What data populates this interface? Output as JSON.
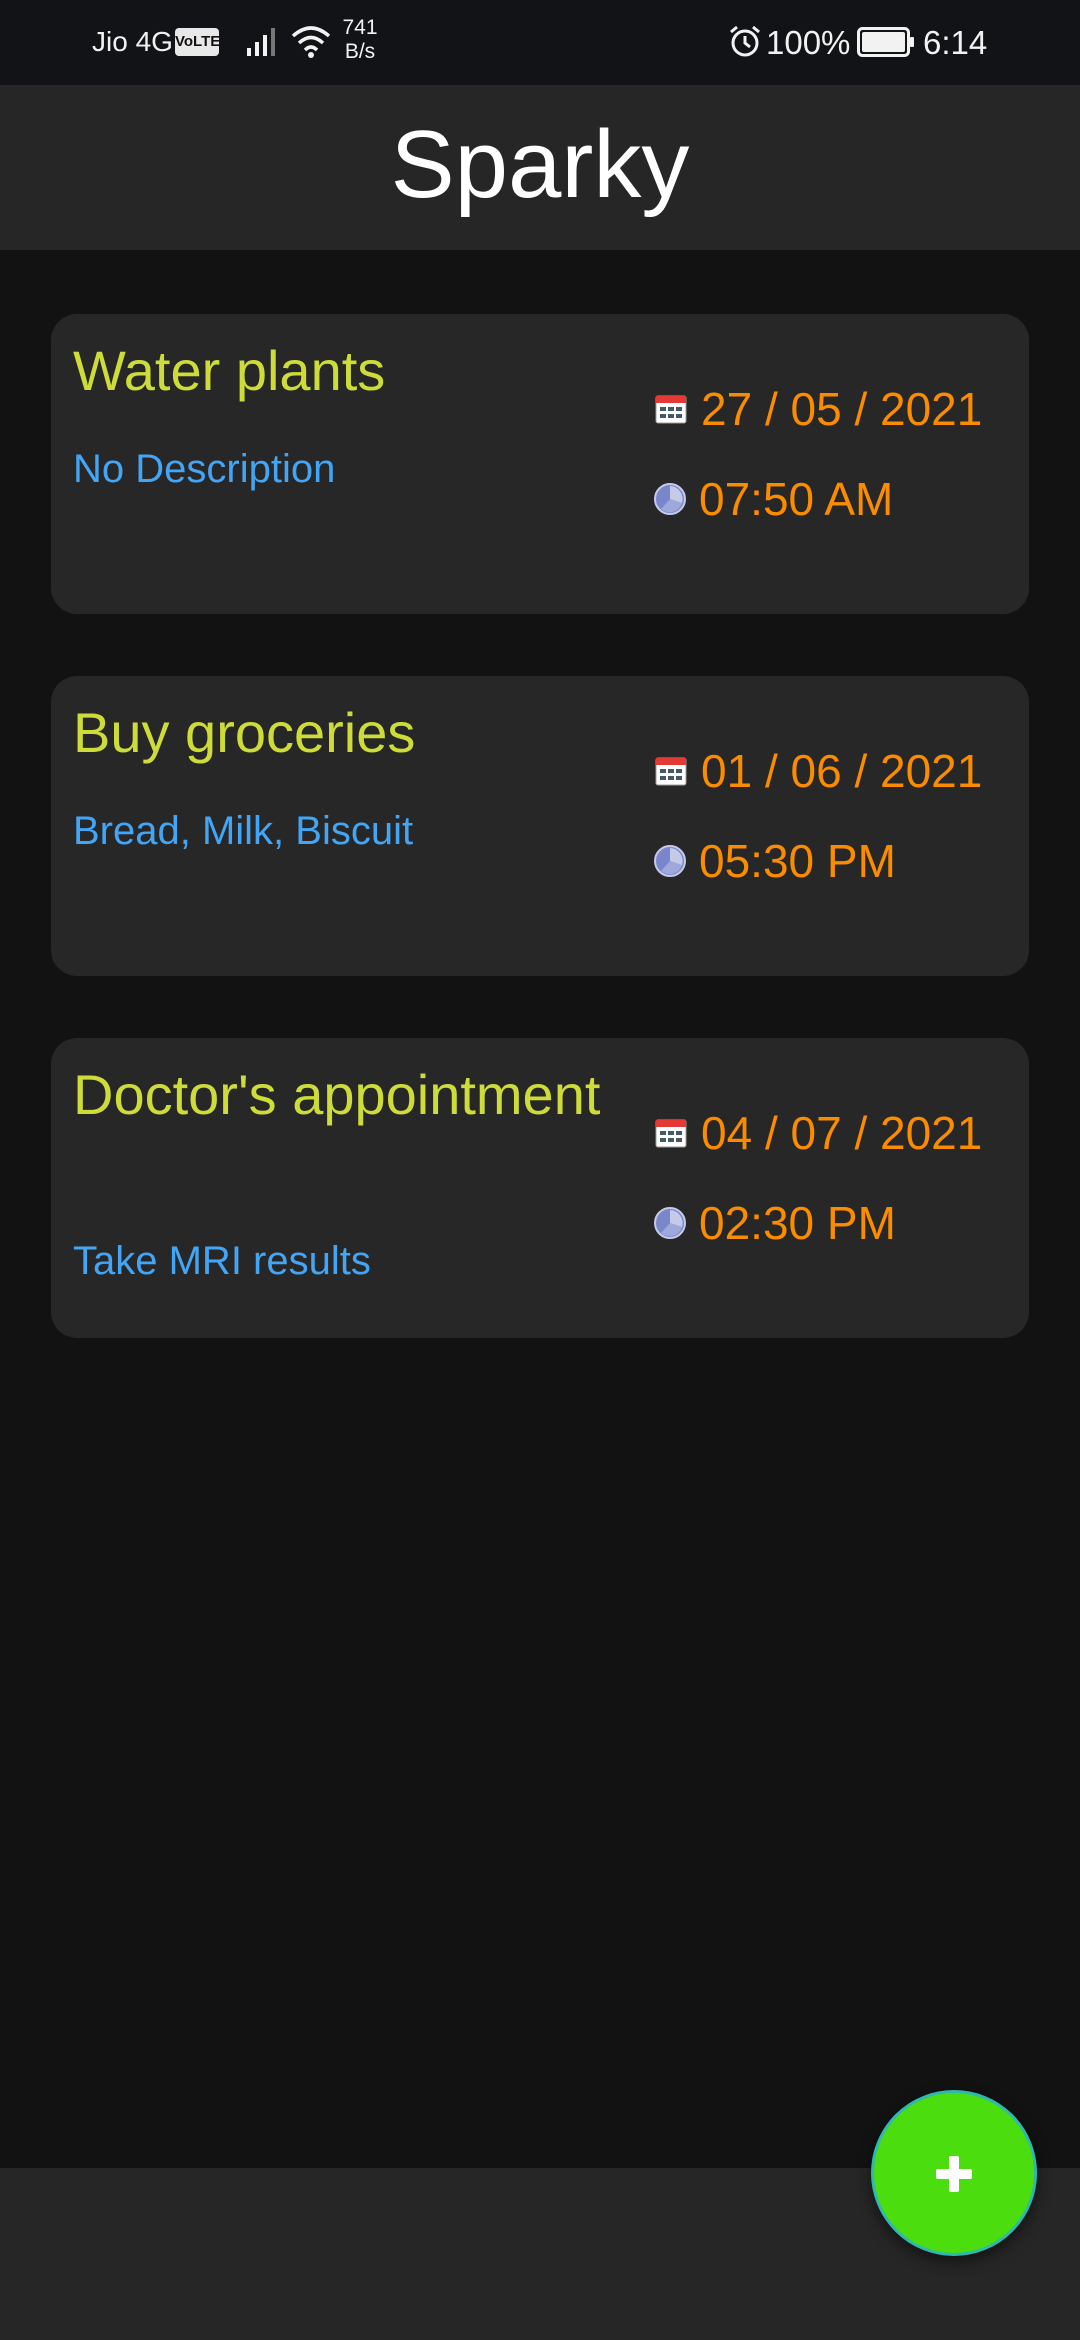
{
  "status_bar": {
    "carrier": "Jio 4G",
    "volte_badge": "VoLTE",
    "net_speed_value": "741",
    "net_speed_unit": "B/s",
    "battery_percent": "100%",
    "time": "6:14",
    "icons": [
      "signal-icon",
      "wifi-icon",
      "alarm-icon",
      "battery-icon"
    ]
  },
  "app": {
    "title": "Sparky"
  },
  "tasks": [
    {
      "title": "Water plants",
      "description": "No Description",
      "date": "27 / 05 / 2021",
      "time": "07:50  AM"
    },
    {
      "title": "Buy groceries",
      "description": "Bread, Milk, Biscuit",
      "date": "01 / 06 / 2021",
      "time": "05:30  PM"
    },
    {
      "title": "Doctor's appointment",
      "description": "Take MRI results",
      "date": "04 / 07 / 2021",
      "time": "02:30  PM"
    }
  ],
  "fab": {
    "icon": "plus-icon"
  },
  "colors": {
    "background": "#121212",
    "bar": "#262626",
    "card": "#272727",
    "title_text": "#cddc39",
    "description_text": "#42a5f5",
    "datetime_text": "#fb8c00",
    "fab": "#4cdd0f"
  }
}
